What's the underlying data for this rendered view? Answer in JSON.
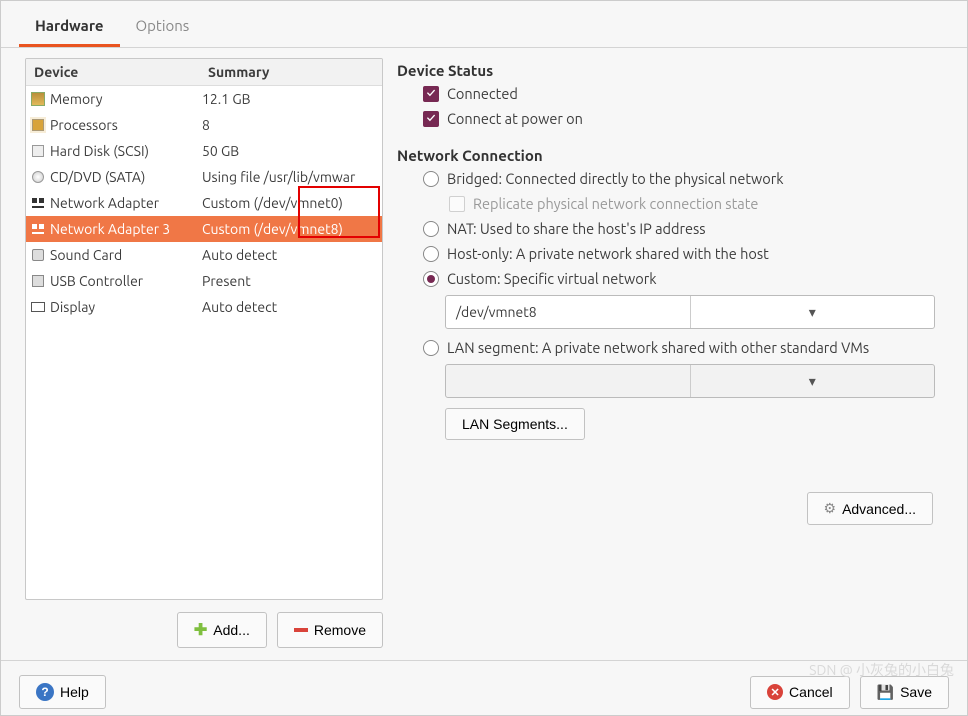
{
  "tabs": {
    "hardware": "Hardware",
    "options": "Options"
  },
  "table_headers": {
    "device": "Device",
    "summary": "Summary"
  },
  "devices": [
    {
      "name": "Memory",
      "summary": "12.1 GB",
      "icon": "memory-icon"
    },
    {
      "name": "Processors",
      "summary": "8",
      "icon": "cpu-icon"
    },
    {
      "name": "Hard Disk (SCSI)",
      "summary": "50 GB",
      "icon": "disk-icon"
    },
    {
      "name": "CD/DVD (SATA)",
      "summary": "Using file /usr/lib/vmwar",
      "icon": "cd-icon"
    },
    {
      "name": "Network Adapter",
      "summary": "Custom (/dev/vmnet0)",
      "icon": "net-icon"
    },
    {
      "name": "Network Adapter 3",
      "summary": "Custom (/dev/vmnet8)",
      "icon": "net-icon",
      "selected": true
    },
    {
      "name": "Sound Card",
      "summary": "Auto detect",
      "icon": "sound-icon"
    },
    {
      "name": "USB Controller",
      "summary": "Present",
      "icon": "usb-icon"
    },
    {
      "name": "Display",
      "summary": "Auto detect",
      "icon": "display-icon"
    }
  ],
  "buttons": {
    "add": "Add...",
    "remove": "Remove",
    "advanced": "Advanced...",
    "lan_segments": "LAN Segments...",
    "help": "Help",
    "cancel": "Cancel",
    "save": "Save"
  },
  "device_status": {
    "title": "Device Status",
    "connected": "Connected",
    "connect_power": "Connect at power on"
  },
  "network_connection": {
    "title": "Network Connection",
    "bridged": "Bridged: Connected directly to the physical network",
    "replicate": "Replicate physical network connection state",
    "nat": "NAT: Used to share the host's IP address",
    "hostonly": "Host-only: A private network shared with the host",
    "custom": "Custom: Specific virtual network",
    "custom_value": "/dev/vmnet8",
    "lan": "LAN segment: A private network shared with other standard VMs"
  },
  "watermark": "SDN @ 小灰兔的小白兔"
}
